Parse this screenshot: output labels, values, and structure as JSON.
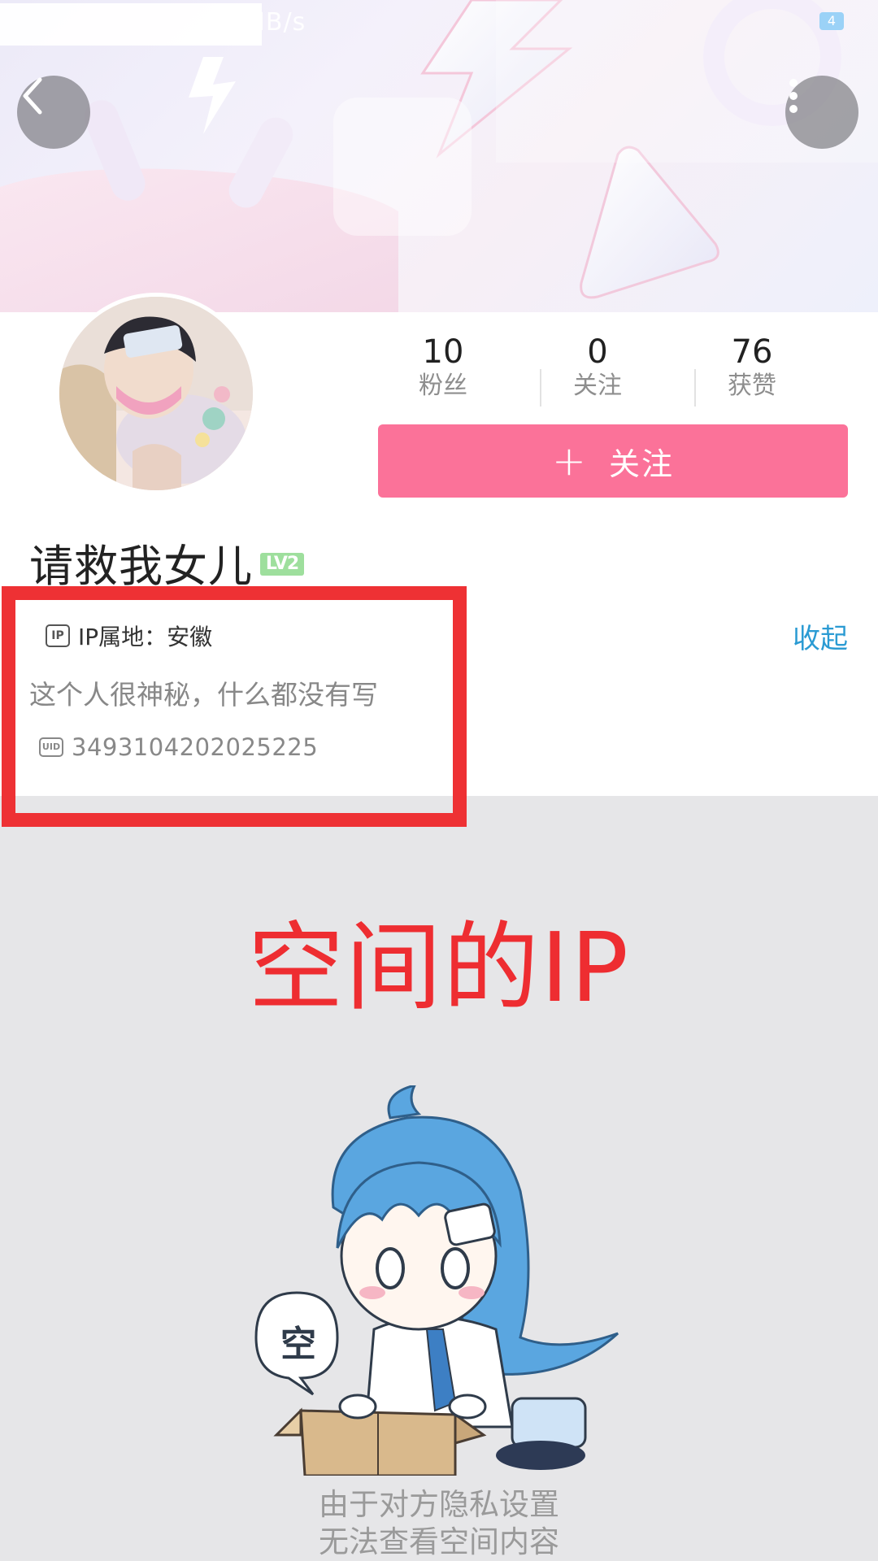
{
  "status_bar": {
    "speed": "MB/s",
    "battery": "4"
  },
  "header": {
    "back_icon": "chevron-left-icon",
    "more_icon": "more-vertical-icon"
  },
  "profile": {
    "stats": [
      {
        "value": "10",
        "label": "粉丝"
      },
      {
        "value": "0",
        "label": "关注"
      },
      {
        "value": "76",
        "label": "获赞"
      }
    ],
    "follow_button": {
      "icon": "+",
      "label": "关注"
    },
    "username": "请救我女儿",
    "level": "LV2",
    "ip_location": "IP属地：安徽",
    "ip_icon_text": "IP",
    "collapse_label": "收起",
    "bio": "这个人很神秘，什么都没有写",
    "uid_icon_text": "UID",
    "uid": "3493104202025225"
  },
  "annotation": {
    "title": "空间的IP",
    "color": "#ee2d31"
  },
  "empty_state": {
    "bubble_text": "空",
    "line1": "由于对方隐私设置",
    "line2": "无法查看空间内容"
  },
  "colors": {
    "accent_pink": "#fb7299",
    "link_blue": "#2b9bd3",
    "level_green": "#9edf9d"
  }
}
